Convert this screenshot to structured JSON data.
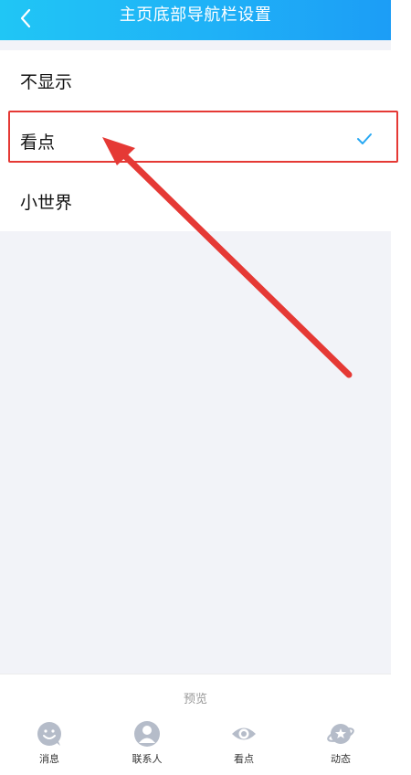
{
  "header": {
    "title": "主页底部导航栏设置",
    "back_icon": "chevron-left-icon"
  },
  "options": [
    {
      "label": "不显示",
      "selected": false
    },
    {
      "label": "看点",
      "selected": true
    },
    {
      "label": "小世界",
      "selected": false
    }
  ],
  "preview": {
    "label": "预览"
  },
  "tabbar": [
    {
      "label": "消息",
      "icon": "message-icon"
    },
    {
      "label": "联系人",
      "icon": "contacts-icon"
    },
    {
      "label": "看点",
      "icon": "eye-icon"
    },
    {
      "label": "动态",
      "icon": "planet-icon"
    }
  ],
  "colors": {
    "header_start": "#20c6f5",
    "header_end": "#1c9df6",
    "check": "#27a8f3",
    "annotation": "#e53935",
    "tab_icon": "#b5bcc9"
  }
}
